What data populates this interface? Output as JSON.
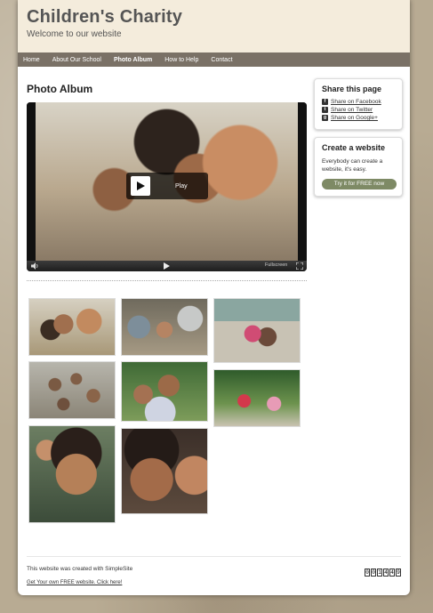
{
  "header": {
    "site_title": "Children's Charity",
    "tagline": "Welcome to our website"
  },
  "nav": {
    "items": [
      {
        "label": "Home"
      },
      {
        "label": "About Our School"
      },
      {
        "label": "Photo Album"
      },
      {
        "label": "How to Help"
      },
      {
        "label": "Contact"
      }
    ],
    "active": "Photo Album"
  },
  "main": {
    "page_title": "Photo Album",
    "video": {
      "play_label": "Play",
      "fullscreen_label": "Fullscreen"
    }
  },
  "sidebar": {
    "share": {
      "title": "Share this page",
      "links": [
        {
          "label": "Share on Facebook",
          "icon": "facebook-icon"
        },
        {
          "label": "Share on Twitter",
          "icon": "twitter-icon"
        },
        {
          "label": "Share on Google+",
          "icon": "googleplus-icon"
        }
      ]
    },
    "create": {
      "title": "Create a website",
      "text": "Everybody can create a website, it's easy.",
      "button_label": "Try it for FREE now"
    }
  },
  "footer": {
    "text": "This website was created with SimpleSite",
    "link": "Get Your own FREE website. Click here!",
    "counter": [
      "0",
      "0",
      "1",
      "4",
      "4",
      "9"
    ]
  },
  "colors": {
    "nav_bg": "#7a7166",
    "header_bg": "#f4ecdc",
    "cta_bg": "#7e8a65"
  }
}
